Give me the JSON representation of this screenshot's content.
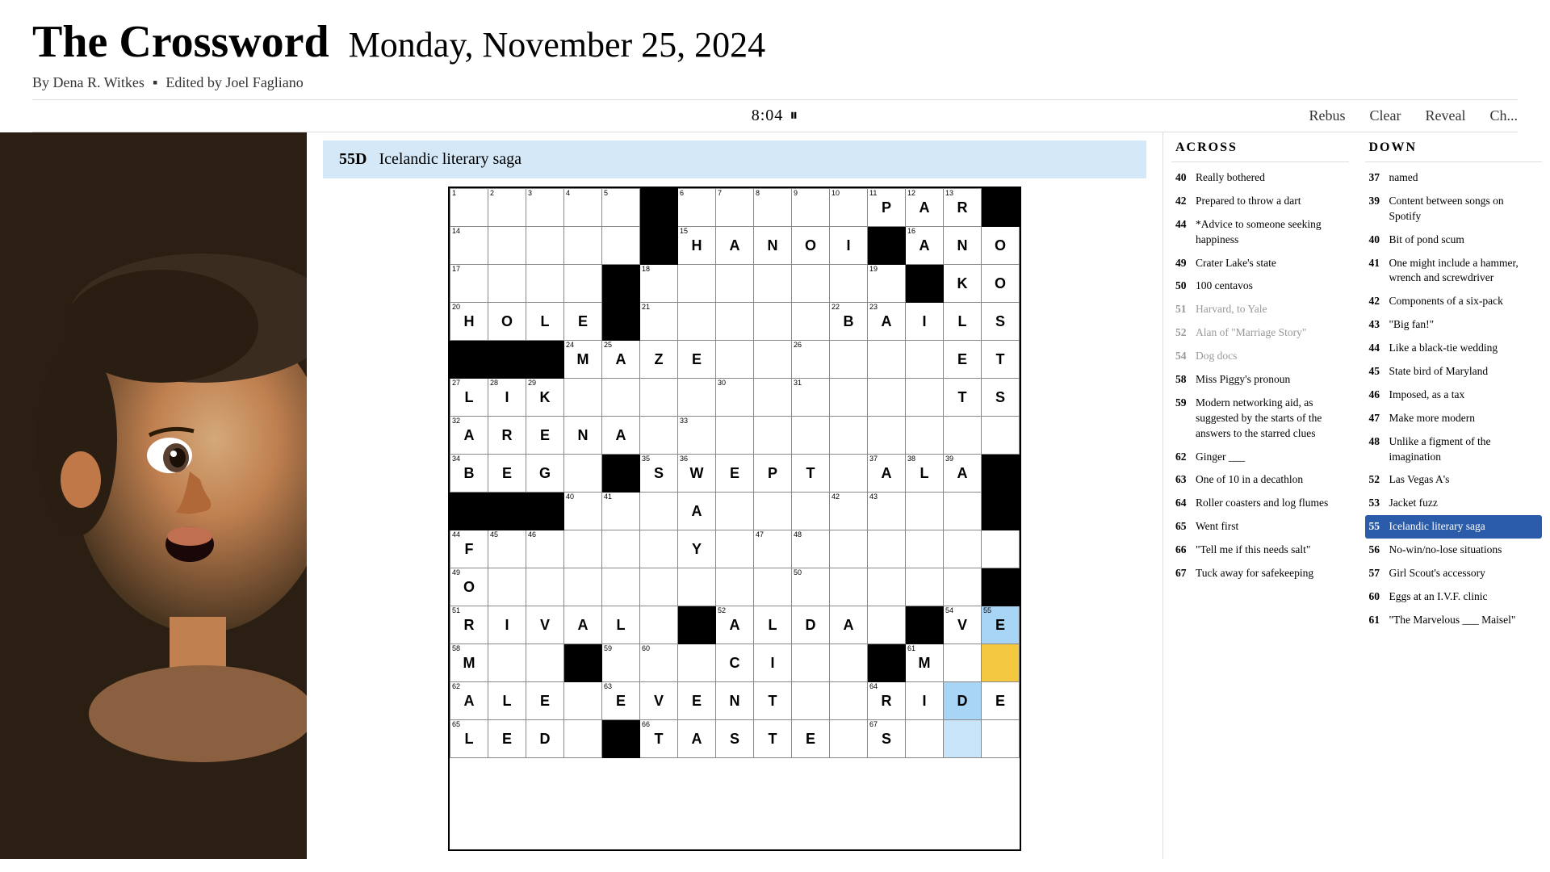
{
  "header": {
    "title": "The Crossword",
    "date": "Monday, November 25, 2024",
    "byline": "By Dena R. Witkes",
    "editor": "Edited by Joel Fagliano"
  },
  "toolbar": {
    "timer": "8:04",
    "rebus_label": "Rebus",
    "clear_label": "Clear",
    "reveal_label": "Reveal",
    "check_label": "Ch..."
  },
  "active_clue": {
    "number": "55D",
    "text": "Icelandic literary saga"
  },
  "across_clues": [
    {
      "num": "40",
      "text": "Really bothered"
    },
    {
      "num": "42",
      "text": "Prepared to throw a dart"
    },
    {
      "num": "44",
      "text": "*Advice to someone seeking happiness"
    },
    {
      "num": "49",
      "text": "Crater Lake's state"
    },
    {
      "num": "50",
      "text": "100 centavos"
    },
    {
      "num": "51",
      "text": "Harvard, to Yale",
      "greyed": true
    },
    {
      "num": "52",
      "text": "Alan of \"Marriage Story\"",
      "greyed": true
    },
    {
      "num": "54",
      "text": "Dog docs",
      "greyed": true
    },
    {
      "num": "58",
      "text": "Miss Piggy's pronoun"
    },
    {
      "num": "59",
      "text": "Modern networking aid, as suggested by the starts of the answers to the starred clues"
    },
    {
      "num": "62",
      "text": "Ginger ___"
    },
    {
      "num": "63",
      "text": "One of 10 in a decathlon"
    },
    {
      "num": "64",
      "text": "Roller coasters and log flumes"
    },
    {
      "num": "65",
      "text": "Went first"
    },
    {
      "num": "66",
      "text": "\"Tell me if this needs salt\""
    },
    {
      "num": "67",
      "text": "Tuck away for safekeeping"
    }
  ],
  "down_clues": [
    {
      "num": "37",
      "text": "named"
    },
    {
      "num": "39",
      "text": "Content between songs on Spotify"
    },
    {
      "num": "40",
      "text": "Bit of pond scum"
    },
    {
      "num": "41",
      "text": "One might include a hammer, wrench and screwdriver"
    },
    {
      "num": "42",
      "text": "Components of a six-pack"
    },
    {
      "num": "43",
      "text": "\"Big fan!\""
    },
    {
      "num": "44",
      "text": "Like a black-tie wedding"
    },
    {
      "num": "45",
      "text": "State bird of Maryland"
    },
    {
      "num": "46",
      "text": "Imposed, as a tax"
    },
    {
      "num": "47",
      "text": "Make more modern"
    },
    {
      "num": "48",
      "text": "Unlike a figment of the imagination"
    },
    {
      "num": "52",
      "text": "Las Vegas A's"
    },
    {
      "num": "53",
      "text": "Jacket fuzz"
    },
    {
      "num": "55",
      "text": "Icelandic literary saga",
      "active": true
    },
    {
      "num": "56",
      "text": "No-win/no-lose situations"
    },
    {
      "num": "57",
      "text": "Girl Scout's accessory"
    },
    {
      "num": "60",
      "text": "Eggs at an I.V.F. clinic"
    },
    {
      "num": "61",
      "text": "\"The Marvelous ___ Maisel\""
    }
  ]
}
